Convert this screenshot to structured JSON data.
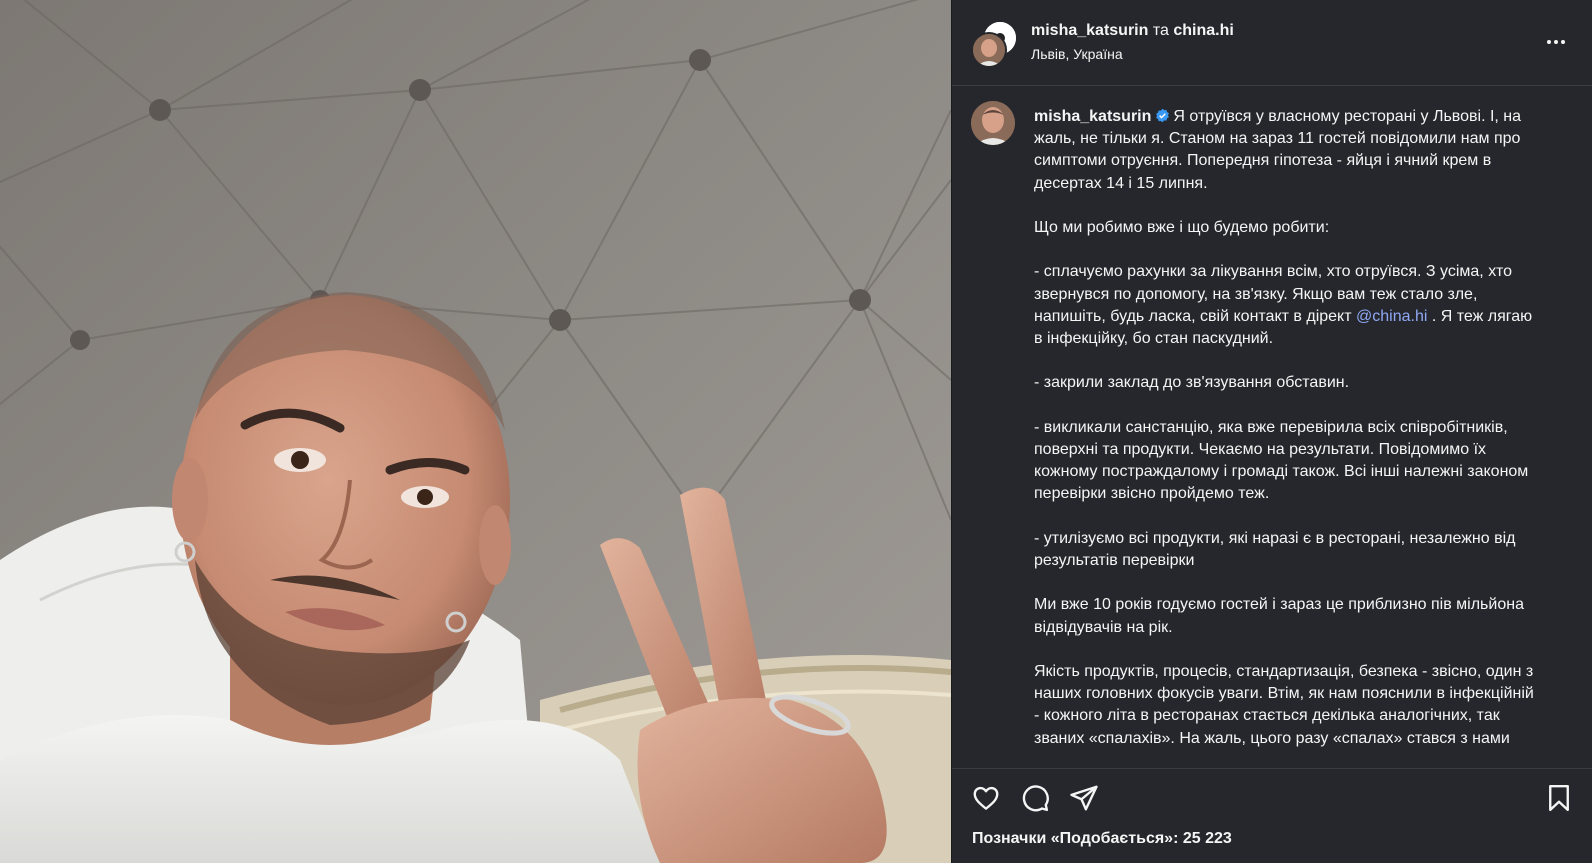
{
  "header": {
    "user1": "misha_katsurin",
    "conjunction": "та",
    "user2": "china.hi",
    "location": "Львів, Україна"
  },
  "caption": {
    "username": "misha_katsurin",
    "p1": "Я отруївся у власному ресторані у Львові. І, на жаль, не тільки я. Станом на зараз 11 гостей повідомили нам про симптоми отруєння. Попередня гіпотеза - яйця і ячний крем в десертах 14 і 15 липня.",
    "p2": "Що ми робимо вже і що будемо робити:",
    "p3a": "- сплачуємо рахунки за лікування всім, хто отруївся. З усіма, хто звернувся по допомогу, на зв'язку. Якщо вам теж стало зле, напишіть, будь ласка, свій контакт в дірект ",
    "mention": "@china.hi",
    "p3b": " . Я теж лягаю в інфекційку, бо стан паскудний.",
    "p4": "- закрили заклад до зв'язування обставин.",
    "p5": "- викликали санстанцію, яка вже перевірила всіх співробітників, поверхні та продукти. Чекаємо на результати. Повідомимо їх кожному постраждалому і громаді також. Всі інші належні законом перевірки звісно пройдемо теж.",
    "p6": "- утилізуємо всі продукти, які наразі є в ресторані, незалежно від результатів перевірки",
    "p7": "Ми вже 10 років годуємо гостей і зараз це приблизно пів мільйона відвідувачів на рік.",
    "p8": "Якість продуктів, процесів, стандартизація, безпека - звісно, один з наших головних фокусів уваги. Втім, як нам пояснили в інфекційній - кожного літа в ресторанах стається декілька аналогічних, так званих «спалахів». На жаль, цього разу «спалах» стався з нами"
  },
  "likes": {
    "label": "Позначки «Подобається»: 25 223"
  },
  "icons": {
    "like": "heart-icon",
    "comment": "comment-icon",
    "share": "send-icon",
    "save": "bookmark-icon",
    "more": "more-icon",
    "verified": "verified-badge-icon"
  },
  "colors": {
    "panel_bg": "#25272c",
    "text": "#f5f5f5",
    "mention": "#8fa8f5",
    "verified": "#3897f0"
  }
}
